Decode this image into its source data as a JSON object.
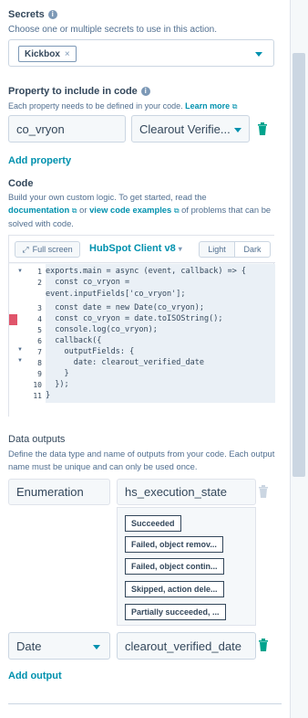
{
  "secrets": {
    "label": "Secrets",
    "help": "Choose one or multiple secrets to use in this action.",
    "selected_tag": "Kickbox",
    "tag_remove": "×"
  },
  "property": {
    "label": "Property to include in code",
    "help": "Each property needs to be defined in your code.",
    "learn_more": "Learn more",
    "name_value": "co_vryon",
    "property_value": "Clearout Verifie...",
    "add_label": "Add property"
  },
  "code": {
    "label": "Code",
    "help_1": "Build your own custom logic. To get started, read the",
    "doc_link": "documentation",
    "or_text": "or",
    "examples_link": "view code examples",
    "help_2": "of problems that can be solved with code.",
    "fullscreen": "Full screen",
    "client": "HubSpot Client v8",
    "theme_light": "Light",
    "theme_dark": "Dark",
    "lines": [
      {
        "n": "1",
        "text": "exports.main = async (event, callback) => {"
      },
      {
        "n": "2",
        "text": "  const co_vryon ="
      },
      {
        "n": "",
        "text": "event.inputFields['co_vryon'];"
      },
      {
        "n": "3",
        "text": "  const date = new Date(co_vryon);"
      },
      {
        "n": "4",
        "text": "  const co_vryon = date.toISOString();"
      },
      {
        "n": "5",
        "text": "  console.log(co_vryon);"
      },
      {
        "n": "6",
        "text": "  callback({"
      },
      {
        "n": "7",
        "text": "    outputFields: {"
      },
      {
        "n": "8",
        "text": "      date: clearout_verified_date"
      },
      {
        "n": "9",
        "text": "    }"
      },
      {
        "n": "10",
        "text": "  });"
      },
      {
        "n": "11",
        "text": "}"
      }
    ]
  },
  "outputs": {
    "label": "Data outputs",
    "help": "Define the data type and name of outputs from your code. Each output name must be unique and can only be used once.",
    "row1_type": "Enumeration",
    "row1_name": "hs_execution_state",
    "options": [
      "Succeeded",
      "Failed, object remov...",
      "Failed, object contin...",
      "Skipped, action dele...",
      "Partially succeeded, ..."
    ],
    "row2_type": "Date",
    "row2_name": "clearout_verified_date",
    "add_label": "Add output"
  },
  "colors": {
    "accent": "#0091ae",
    "delete_active": "#00a38d",
    "delete_disabled": "#cbd6e2"
  }
}
